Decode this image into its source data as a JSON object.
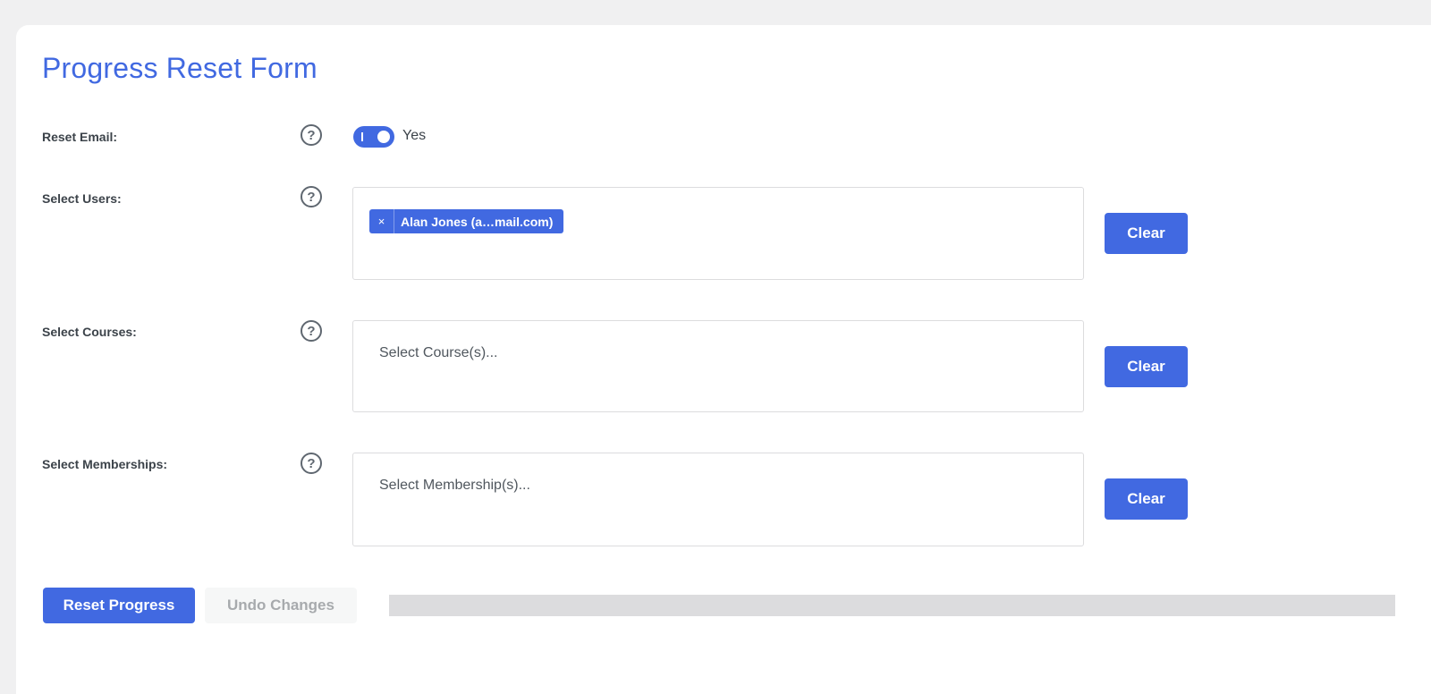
{
  "form": {
    "title": "Progress Reset Form",
    "reset_email": {
      "label": "Reset Email:",
      "toggle_on": true,
      "toggle_text": "Yes"
    },
    "users": {
      "label": "Select Users:",
      "selected": [
        {
          "text": "Alan Jones (a…mail.com)"
        }
      ],
      "clear_label": "Clear"
    },
    "courses": {
      "label": "Select Courses:",
      "placeholder": "Select Course(s)...",
      "clear_label": "Clear"
    },
    "memberships": {
      "label": "Select Memberships:",
      "placeholder": "Select Membership(s)...",
      "clear_label": "Clear"
    },
    "actions": {
      "reset_label": "Reset Progress",
      "undo_label": "Undo Changes"
    },
    "progress_fraction": 0,
    "help_glyph": "?",
    "chip_remove_glyph": "×"
  },
  "colors": {
    "accent": "#4169e1",
    "progress_track": "#dcdcde",
    "disabled_bg": "#f6f7f7",
    "disabled_text": "#a7aaad"
  },
  "icons": [
    "help-circle-icon",
    "close-icon"
  ]
}
